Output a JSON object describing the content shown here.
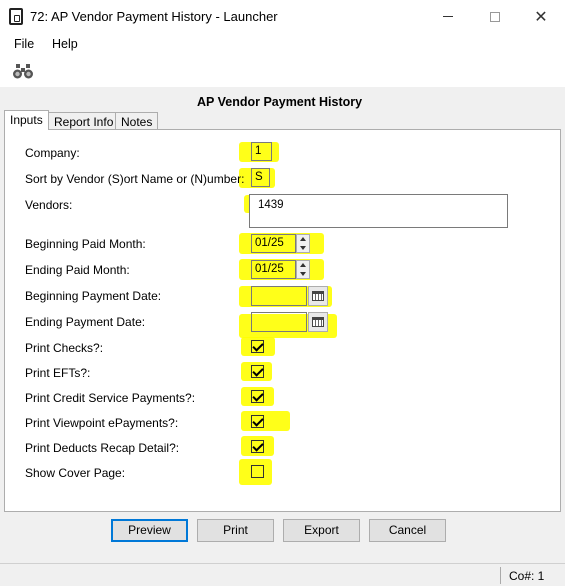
{
  "window": {
    "title": "72: AP Vendor Payment History - Launcher",
    "close_glyph": "✕"
  },
  "menu": {
    "file": "File",
    "help": "Help"
  },
  "toolbar": {
    "icon": "binoculars-icon"
  },
  "form": {
    "heading": "AP Vendor Payment History",
    "tabs": [
      "Inputs",
      "Report Info",
      "Notes"
    ],
    "active_tab": "Inputs",
    "labels": {
      "company": "Company:",
      "sort_by": "Sort by Vendor (S)ort Name or (N)umber:",
      "vendors": "Vendors:",
      "beginning_paid_month": "Beginning Paid Month:",
      "ending_paid_month": "Ending Paid Month:",
      "beginning_payment_date": "Beginning Payment Date:",
      "ending_payment_date": "Ending Payment Date:",
      "print_checks": "Print Checks?:",
      "print_efts": "Print EFTs?:",
      "print_credit_service": "Print Credit Service Payments?:",
      "print_viewpoint_epayments": "Print Viewpoint ePayments?:",
      "print_deducts_recap": "Print Deducts Recap Detail?:",
      "show_cover_page": "Show Cover Page:"
    },
    "values": {
      "company": "1",
      "sort_by": "S",
      "vendors": "1439",
      "beginning_paid_month": "01/25",
      "ending_paid_month": "01/25",
      "beginning_payment_date": "",
      "ending_payment_date": ""
    },
    "checkboxes": {
      "print_checks": true,
      "print_efts": true,
      "print_credit_service": true,
      "print_viewpoint_epayments": true,
      "print_deducts_recap": true,
      "show_cover_page": false
    },
    "highlight_color": "#ffff00"
  },
  "buttons": {
    "preview": "Preview",
    "print": "Print",
    "export": "Export",
    "cancel": "Cancel"
  },
  "status": {
    "company": "Co#: 1"
  }
}
